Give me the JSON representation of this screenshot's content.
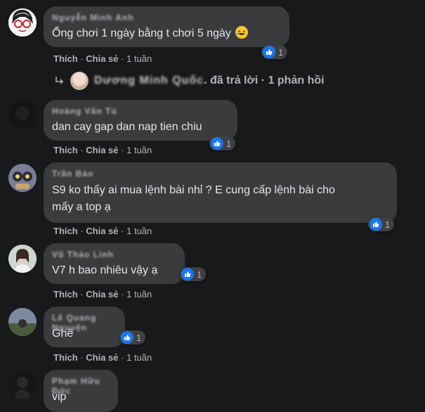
{
  "actions": {
    "like": "Thích",
    "share": "Chia sẻ",
    "sep": "·",
    "time": "1 tuần"
  },
  "comments": [
    {
      "name": "Nguyễn Minh Anh",
      "text": "Ổng chơi 1 ngày bằng t chơi 5 ngày",
      "emoji": "rolling-laughing-emoji",
      "reactions": "1",
      "reply": {
        "name": "Dương Minh Quốc",
        "summary": ". đã trả lời · 1 phản hồi"
      }
    },
    {
      "name": "Hoàng Văn Tú",
      "text": "dan cay gap dan nap tien chiu",
      "reactions": "1"
    },
    {
      "name": "Trần Bảo",
      "text": "S9 ko thấy ai mua lệnh bài nhỉ ? E cung cấp lệnh bài cho\nmấy a top ạ",
      "reactions": "1"
    },
    {
      "name": "Vũ Thảo Linh",
      "text": "V7 h bao nhiêu vậy ạ",
      "reactions": "1"
    },
    {
      "name": "Lê Quang Nguyện",
      "text": "Ghê",
      "reactions": "1"
    },
    {
      "name": "Phạm Hữu Đức",
      "text": "vip",
      "reactions": ""
    }
  ],
  "colors": {
    "background": "#18191a",
    "bubble": "#3a3b3c",
    "like": "#1877f2",
    "secondary_text": "#b0b3b8"
  }
}
